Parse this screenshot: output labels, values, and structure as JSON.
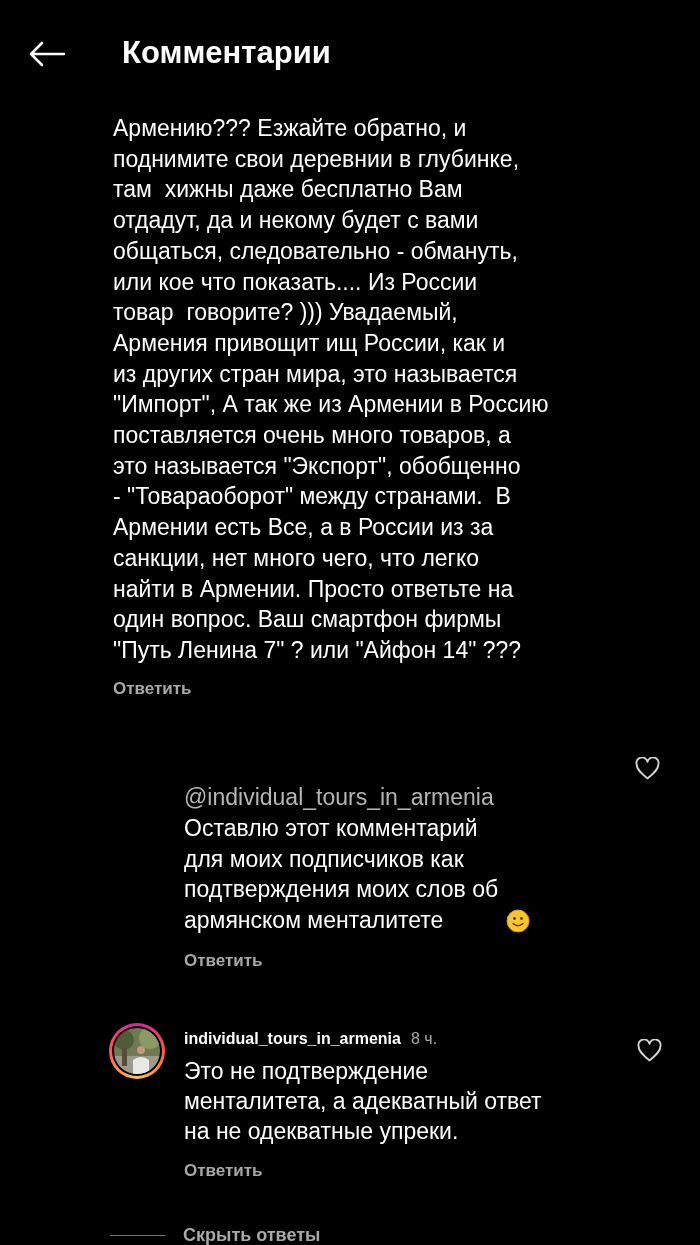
{
  "header": {
    "title": "Комментарии"
  },
  "comments": [
    {
      "kind": "plain",
      "text": "Армению??? Езжайте обратно, и\nподнимите свои деревнии в глубинке,\nтам  хижны даже бесплатно Вам\nотдадут, да и некому будет с вами\nобщаться, следовательно - обмануть,\nили кое что показать.... Из России\nтовар  говорите? ))) Увадаемый,\nАрмения привощит ищ России, как и\nиз других стран мира, это называется\n\"Импорт\", А так же из Армении в Россию\nпоставляется очень много товаров, а\nэто называется \"Экспорт\", обобщенно\n- \"Товараоборот\" между странами.  В\nАрмении есть Все, а в России из за\nсанкции, нет много чего, что легко\nнайти в Армении. Просто ответьте на\nодин вопрос. Ваш смартфон фирмы\n\"Путь Ленина 7\" ? или \"Айфон 14\" ???",
      "reply": "Ответить"
    },
    {
      "kind": "mention",
      "liked": false,
      "mention": "@individual_tours_in_armenia",
      "text": "Оставлю этот комментарий\nдля моих подписчиков как\nподтверждения моих слов об\nармянском менталитете",
      "reply": "Ответить"
    },
    {
      "kind": "user",
      "liked": false,
      "username": "individual_tours_in_armenia",
      "time": "8 ч.",
      "text": "Это не подтверждение\nменталитета, а адекватный ответ\nна не одекватные упреки.",
      "reply": "Ответить"
    }
  ],
  "hide_replies": "Скрыть ответы"
}
